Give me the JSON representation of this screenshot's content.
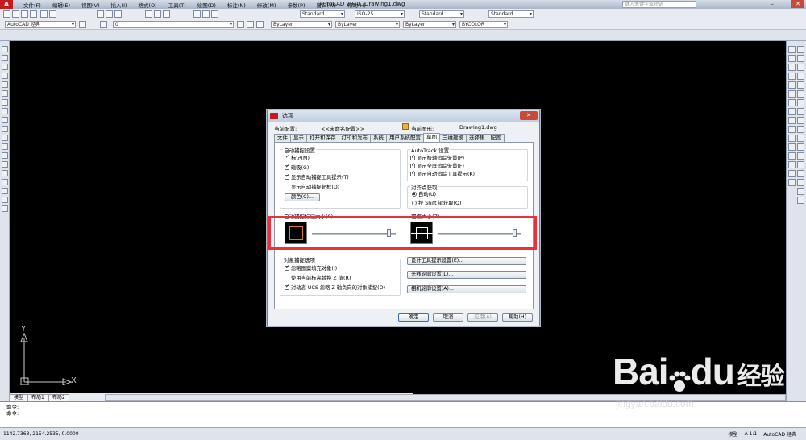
{
  "app": {
    "title": "AutoCAD 2010",
    "file": "Drawing1.dwg",
    "search_placeholder": "键入关键字或短语",
    "menu": [
      "文件(F)",
      "编辑(E)",
      "视图(V)",
      "插入(I)",
      "格式(O)",
      "工具(T)",
      "绘图(D)",
      "标注(N)",
      "修改(M)",
      "参数(P)",
      "窗口(W)",
      "帮助(H)"
    ]
  },
  "toolbar": {
    "text_style": "Standard",
    "dim_style": "ISO-25",
    "table_style": "Standard",
    "mleader_style": "Standard",
    "workspace": "AutoCAD 经典",
    "layer": "0",
    "color": "ByLayer",
    "linetype": "ByLayer",
    "lineweight": "ByLayer",
    "plotstyle": "BYCOLOR"
  },
  "canvas": {
    "ucs_x": "X",
    "ucs_y": "Y"
  },
  "layout_tabs": [
    "模型",
    "布局1",
    "布局2"
  ],
  "command_lines": [
    "命令:",
    "命令:"
  ],
  "status": {
    "coords": "1142.7363, 2154.2535, 0.0000",
    "model": "模型",
    "scale": "A 1:1",
    "workspace": "AutoCAD 经典"
  },
  "dialog": {
    "title": "选项",
    "close_label": "✕",
    "profile_label": "当前配置:",
    "profile_value": "<<未命名配置>>",
    "drawing_label": "当前图形:",
    "drawing_value": "Drawing1.dwg",
    "tabs": [
      "文件",
      "显示",
      "打开和保存",
      "打印和发布",
      "系统",
      "用户系统配置",
      "草图",
      "三维建模",
      "选择集",
      "配置"
    ],
    "active_tab": "草图",
    "autosnap": {
      "title": "自动捕捉设置",
      "marker": "标记(M)",
      "magnet": "磁吸(G)",
      "tooltip": "显示自动捕捉工具提示(T)",
      "aperture_box": "显示自动捕捉靶框(D)",
      "colors_button": "颜色(C)..."
    },
    "autotrack": {
      "title": "AutoTrack 设置",
      "polar": "显示极轴追踪矢量(P)",
      "fullscreen": "显示全屏追踪矢量(F)",
      "tooltip": "显示自动追踪工具提示(K)"
    },
    "alignment": {
      "title": "对齐点获取",
      "auto": "自动(U)",
      "shift": "按 Shift 键获取(Q)"
    },
    "marker_size_title": "自动捕捉标记大小(S)",
    "aperture_size_title": "靶框大小(Z)",
    "osnap": {
      "title": "对象捕捉选项",
      "ignore_hatch": "忽略图案填充对象(I)",
      "replace_z": "使用当前标高替换 Z 值(R)",
      "ignore_z": "对动态 UCS 忽略 Z 轴负向的对象捕捉(O)"
    },
    "buttons": {
      "tooltip_settings": "设计工具提示设置(E)...",
      "lightglyph": "光线轮廓设置(L)...",
      "camera_glyph": "相机轮廓设置(A)...",
      "ok": "确定",
      "cancel": "取消",
      "apply": "应用(A)",
      "help": "帮助(H)"
    },
    "states": {
      "marker": true,
      "magnet": true,
      "tooltip": true,
      "aperture_box": false,
      "polar": true,
      "fullscreen": true,
      "track_tooltip": true,
      "ignore_hatch": true,
      "replace_z": false,
      "ignore_z": true,
      "alignment": "auto",
      "marker_size_fraction": 0.94,
      "aperture_size_fraction": 0.94
    }
  },
  "watermark": {
    "brand": "Bai",
    "brand2": "du",
    "brand_cn": "经验",
    "url": "jingyan.baidu.com"
  },
  "colors": {
    "canvas": "#000000",
    "highlight": "#e8323a",
    "marker": "#e07a2a"
  }
}
